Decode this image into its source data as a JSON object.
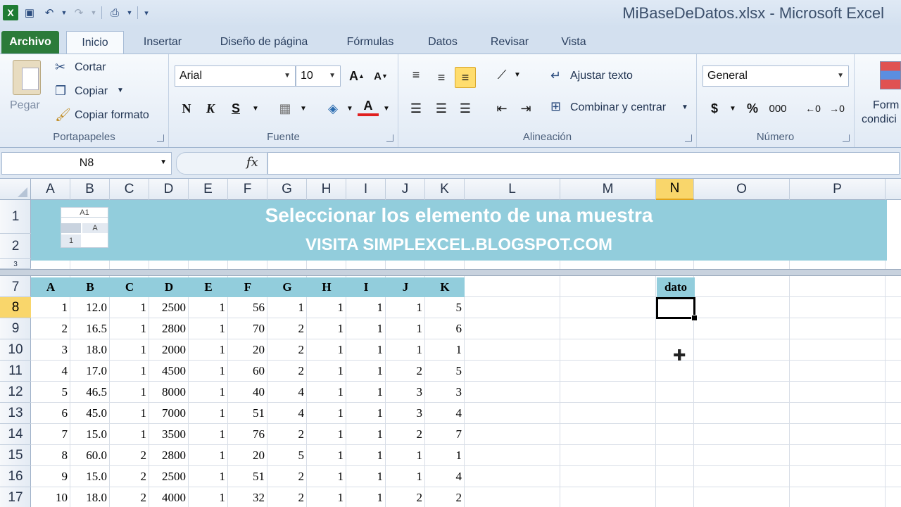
{
  "window": {
    "title": "MiBaseDeDatos.xlsx  -  Microsoft Excel"
  },
  "qat": {
    "app_logo": "X"
  },
  "tabs": [
    {
      "label": "Archivo"
    },
    {
      "label": "Inicio"
    },
    {
      "label": "Insertar"
    },
    {
      "label": "Diseño de página"
    },
    {
      "label": "Fórmulas"
    },
    {
      "label": "Datos"
    },
    {
      "label": "Revisar"
    },
    {
      "label": "Vista"
    }
  ],
  "ribbon": {
    "clipboard": {
      "paste": "Pegar",
      "cut": "Cortar",
      "copy": "Copiar",
      "format_painter": "Copiar formato",
      "label": "Portapapeles"
    },
    "font": {
      "name": "Arial",
      "size": "10",
      "bold": "N",
      "italic": "K",
      "underline": "S",
      "label": "Fuente"
    },
    "alignment": {
      "wrap": "Ajustar texto",
      "merge": "Combinar y centrar",
      "label": "Alineación"
    },
    "number": {
      "format": "General",
      "currency": "$",
      "percent": "%",
      "thousands": "000",
      "label": "Número"
    },
    "styles": {
      "cond_format_line1": "Form",
      "cond_format_line2": "condici"
    }
  },
  "formula_bar": {
    "name_box": "N8",
    "fx": "fx",
    "content": ""
  },
  "columns": [
    "A",
    "B",
    "C",
    "D",
    "E",
    "F",
    "G",
    "H",
    "I",
    "J",
    "K",
    "L",
    "M",
    "N",
    "O",
    "P"
  ],
  "selected_column": "N",
  "rows": [
    "1",
    "2",
    "3",
    "7",
    "8",
    "9",
    "10",
    "11",
    "12",
    "13",
    "14",
    "15",
    "16",
    "17"
  ],
  "selected_row": "8",
  "banner": {
    "title": "Seleccionar los elemento de una muestra",
    "subtitle": "VISITA SIMPLEXCEL.BLOGSPOT.COM",
    "mini_name": "A1",
    "mini_col": "A",
    "mini_row": "1"
  },
  "table": {
    "headers": [
      "A",
      "B",
      "C",
      "D",
      "E",
      "F",
      "G",
      "H",
      "I",
      "J",
      "K"
    ],
    "rows": [
      [
        "1",
        "12.0",
        "1",
        "2500",
        "1",
        "56",
        "1",
        "1",
        "1",
        "1",
        "5"
      ],
      [
        "2",
        "16.5",
        "1",
        "2800",
        "1",
        "70",
        "2",
        "1",
        "1",
        "1",
        "6"
      ],
      [
        "3",
        "18.0",
        "1",
        "2000",
        "1",
        "20",
        "2",
        "1",
        "1",
        "1",
        "1"
      ],
      [
        "4",
        "17.0",
        "1",
        "4500",
        "1",
        "60",
        "2",
        "1",
        "1",
        "2",
        "5"
      ],
      [
        "5",
        "46.5",
        "1",
        "8000",
        "1",
        "40",
        "4",
        "1",
        "1",
        "3",
        "3"
      ],
      [
        "6",
        "45.0",
        "1",
        "7000",
        "1",
        "51",
        "4",
        "1",
        "1",
        "3",
        "4"
      ],
      [
        "7",
        "15.0",
        "1",
        "3500",
        "1",
        "76",
        "2",
        "1",
        "1",
        "2",
        "7"
      ],
      [
        "8",
        "60.0",
        "2",
        "2800",
        "1",
        "20",
        "5",
        "1",
        "1",
        "1",
        "1"
      ],
      [
        "9",
        "15.0",
        "2",
        "2500",
        "1",
        "51",
        "2",
        "1",
        "1",
        "1",
        "4"
      ],
      [
        "10",
        "18.0",
        "2",
        "4000",
        "1",
        "32",
        "2",
        "1",
        "1",
        "2",
        "2"
      ]
    ]
  },
  "dato_header": "dato"
}
